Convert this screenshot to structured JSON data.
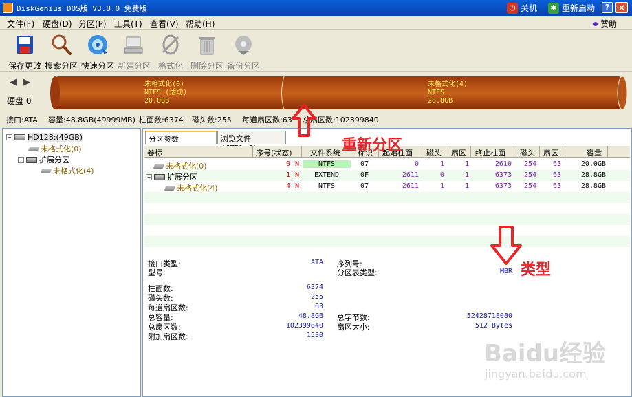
{
  "titlebar": {
    "title": "DiskGenius DOS版 V3.8.0 免费版",
    "shutdown": "关机",
    "restart": "重新启动"
  },
  "menubar": {
    "items": [
      "文件(F)",
      "硬盘(D)",
      "分区(P)",
      "工具(T)",
      "查看(V)",
      "帮助(H)"
    ],
    "sponsor": "赞助"
  },
  "toolbar": {
    "items": [
      "保存更改",
      "搜索分区",
      "快速分区",
      "新建分区",
      "格式化",
      "删除分区",
      "备份分区"
    ]
  },
  "diskmap": {
    "disk_label": "硬盘 0",
    "part1": {
      "name": "未格式化(0)",
      "fs": "NTFS (活动)",
      "size": "20.0GB"
    },
    "part2": {
      "name": "未格式化(4)",
      "fs": "NTFS",
      "size": "28.8GB"
    }
  },
  "infoline": {
    "interface": "接口:ATA",
    "capacity": "容量:48.8GB(49999MB)",
    "cylinders": "柱面数:6374",
    "heads": "磁头数:255",
    "sectors_per_track": "每道扇区数:63",
    "total_sectors": "总扇区数:102399840"
  },
  "tree": {
    "disk": "HD128:(49GB)",
    "items": [
      "未格式化(0)",
      "扩展分区",
      "未格式化(4)"
    ]
  },
  "tabs": [
    "分区参数(CTRL_D)",
    "浏览文件(CTRL_G)"
  ],
  "grid": {
    "headers": [
      "卷标",
      "序号(状态)",
      "文件系统",
      "标识",
      "起始柱面",
      "磁头",
      "扇区",
      "终止柱面",
      "磁头",
      "扇区",
      "容量"
    ],
    "rows": [
      {
        "label": "未格式化(0)",
        "seq": "0",
        "status": "N",
        "fs": "NTFS",
        "id": "07",
        "start_cyl": "0",
        "start_head": "1",
        "start_sec": "1",
        "end_cyl": "2610",
        "end_head": "254",
        "end_sec": "63",
        "size": "20.0GB"
      },
      {
        "label": "扩展分区",
        "seq": "1",
        "status": "N",
        "fs": "EXTEND",
        "id": "0F",
        "start_cyl": "2611",
        "start_head": "0",
        "start_sec": "1",
        "end_cyl": "6373",
        "end_head": "254",
        "end_sec": "63",
        "size": "28.8GB"
      },
      {
        "label": "未格式化(4)",
        "seq": "4",
        "status": "N",
        "fs": "NTFS",
        "id": "07",
        "start_cyl": "2611",
        "start_head": "1",
        "start_sec": "1",
        "end_cyl": "6373",
        "end_head": "254",
        "end_sec": "63",
        "size": "28.8GB"
      }
    ]
  },
  "details": {
    "interface_type_label": "接口类型:",
    "interface_type": "ATA",
    "model_label": "型号:",
    "serial_label": "序列号:",
    "ptable_label": "分区表类型:",
    "ptable": "MBR",
    "cyl_label": "柱面数:",
    "cyl": "6374",
    "heads_label": "磁头数:",
    "heads": "255",
    "spt_label": "每道扇区数:",
    "spt": "63",
    "cap_label": "总容量:",
    "cap": "48.8GB",
    "tbytes_label": "总字节数:",
    "tbytes": "52428718080",
    "tsec_label": "总扇区数:",
    "tsec": "102399840",
    "ssize_label": "扇区大小:",
    "ssize": "512 Bytes",
    "extra_label": "附加扇区数:",
    "extra": "1530"
  },
  "annotations": {
    "repartition": "重新分区",
    "type": "类型"
  },
  "watermark": {
    "brand": "Baidu经验",
    "url": "jingyan.baidu.com"
  }
}
